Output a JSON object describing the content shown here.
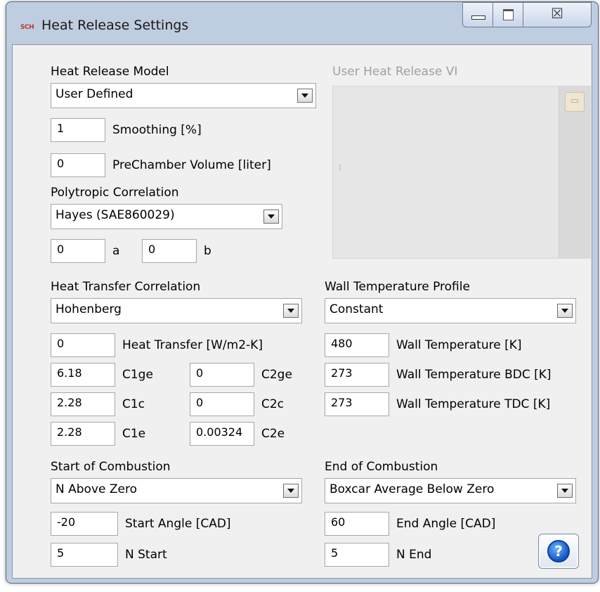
{
  "window": {
    "title": "Heat Release Settings",
    "app_icon_text": "SCH",
    "close_glyph": "☒"
  },
  "heat_release": {
    "model_label": "Heat Release Model",
    "model_value": "User Defined",
    "smoothing_value": "1",
    "smoothing_label": "Smoothing [%]",
    "prechamber_value": "0",
    "prechamber_label": "PreChamber Volume [liter]"
  },
  "user_vi": {
    "label": "User Heat Release VI",
    "browse_icon": "folder-browse-icon"
  },
  "polytropic": {
    "label": "Polytropic Correlation",
    "value": "Hayes (SAE860029)",
    "a_value": "0",
    "a_label": "a",
    "b_value": "0",
    "b_label": "b"
  },
  "heat_transfer": {
    "label": "Heat Transfer Correlation",
    "value": "Hohenberg",
    "ht_value": "0",
    "ht_label": "Heat Transfer [W/m2-K]",
    "c1ge_value": "6.18",
    "c1ge_label": "C1ge",
    "c2ge_value": "0",
    "c2ge_label": "C2ge",
    "c1c_value": "2.28",
    "c1c_label": "C1c",
    "c2c_value": "0",
    "c2c_label": "C2c",
    "c1e_value": "2.28",
    "c1e_label": "C1e",
    "c2e_value": "0.00324",
    "c2e_label": "C2e"
  },
  "wall_temp": {
    "label": "Wall Temperature Profile",
    "value": "Constant",
    "wt_value": "480",
    "wt_label": "Wall Temperature [K]",
    "bdc_value": "273",
    "bdc_label": "Wall Temperature BDC [K]",
    "tdc_value": "273",
    "tdc_label": "Wall Temperature TDC [K]"
  },
  "start_combustion": {
    "label": "Start of Combustion",
    "value": "N Above Zero",
    "angle_value": "-20",
    "angle_label": "Start Angle [CAD]",
    "n_value": "5",
    "n_label": "N Start"
  },
  "end_combustion": {
    "label": "End of Combustion",
    "value": "Boxcar Average Below Zero",
    "angle_value": "60",
    "angle_label": "End Angle [CAD]",
    "n_value": "5",
    "n_label": "N End"
  },
  "help": {
    "glyph": "?"
  }
}
